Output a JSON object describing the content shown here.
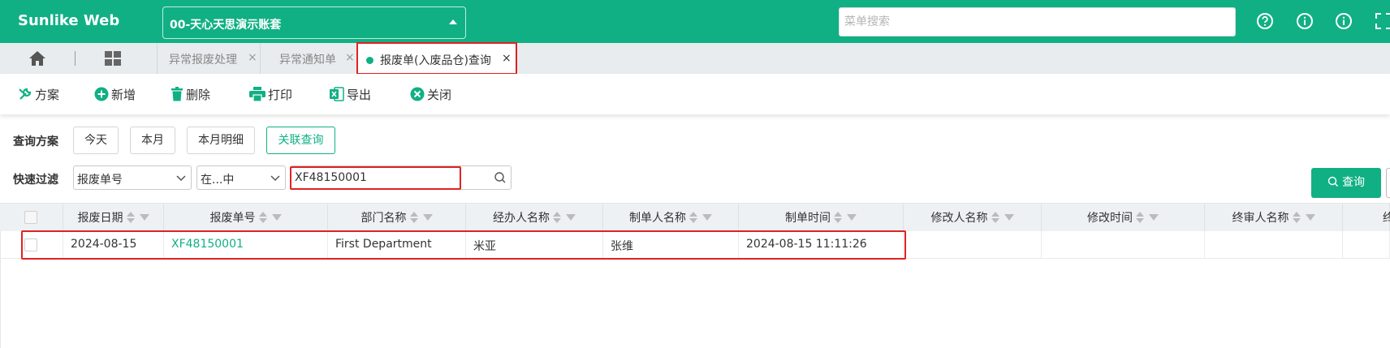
{
  "app": {
    "title": "Sunlike Web"
  },
  "header": {
    "account_label": "00-天心天思演示账套",
    "menu_search_placeholder": "菜单搜索",
    "icons": [
      "help-circle-icon",
      "info-icon",
      "info-icon",
      "fullscreen-icon"
    ]
  },
  "tabs": [
    {
      "label": "异常报废处理",
      "active": false
    },
    {
      "label": "异常通知单",
      "active": false
    },
    {
      "label": "报废单(入废品仓)查询",
      "active": true
    }
  ],
  "toolbar": {
    "scheme": "方案",
    "add": "新增",
    "delete": "删除",
    "print": "打印",
    "export": "导出",
    "close": "关闭"
  },
  "query": {
    "scheme_label": "查询方案",
    "today": "今天",
    "this_month": "本月",
    "month_detail": "本月明细",
    "linked_query": "关联查询",
    "quick_filter_label": "快速过滤",
    "filter_field": "报废单号",
    "filter_operator": "在...中",
    "filter_value": "XF48150001",
    "search_button": "查询"
  },
  "table": {
    "columns": [
      "报废日期",
      "报废单号",
      "部门名称",
      "经办人名称",
      "制单人名称",
      "制单时间",
      "修改人名称",
      "修改时间",
      "终审人名称",
      "终"
    ],
    "rows": [
      {
        "date": "2024-08-15",
        "doc_no": "XF48150001",
        "department": "First Department",
        "handler": "米亚",
        "creator": "张维",
        "created_at": "2024-08-15 11:11:26"
      }
    ]
  },
  "colors": {
    "brand": "#10b084",
    "highlight": "#e02222"
  }
}
